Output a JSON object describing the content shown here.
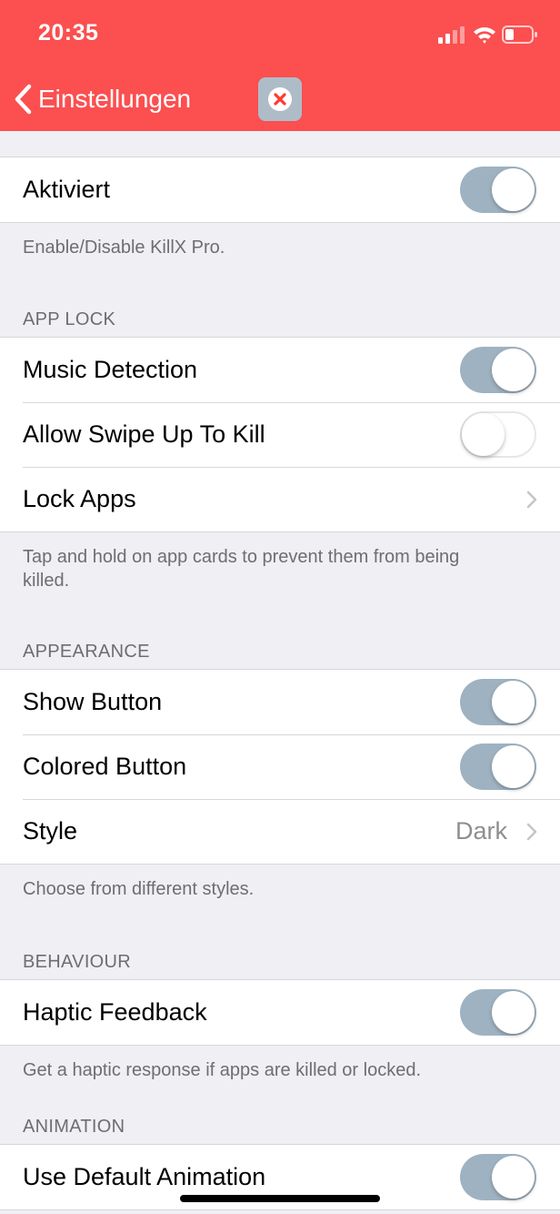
{
  "status_bar": {
    "time": "20:35"
  },
  "nav": {
    "back_label": "Einstellungen"
  },
  "sections": {
    "main": {
      "aktiviert_label": "Aktiviert",
      "aktiviert_on": true,
      "footer": "Enable/Disable KillX Pro."
    },
    "app_lock": {
      "header": "APP LOCK",
      "music_label": "Music Detection",
      "music_on": true,
      "swipe_label": "Allow Swipe Up To Kill",
      "swipe_on": false,
      "lock_apps_label": "Lock Apps",
      "footer": "Tap and hold on app cards to prevent them from being killed."
    },
    "appearance": {
      "header": "APPEARANCE",
      "show_button_label": "Show Button",
      "show_button_on": true,
      "colored_button_label": "Colored Button",
      "colored_button_on": true,
      "style_label": "Style",
      "style_value": "Dark",
      "footer": "Choose from different styles."
    },
    "behaviour": {
      "header": "BEHAVIOUR",
      "haptic_label": "Haptic Feedback",
      "haptic_on": true,
      "footer": "Get a haptic response if apps are killed or locked."
    },
    "animation": {
      "header": "ANIMATION",
      "default_anim_label": "Use Default Animation",
      "default_anim_on": true
    }
  },
  "colors": {
    "accent": "#fb4f50",
    "toggle_on": "#9fb2c1",
    "close_icon_bg": "#aebcc8",
    "close_icon_x": "#ff3b30"
  },
  "icons": [
    "cellular-signal-icon",
    "wifi-icon",
    "battery-icon",
    "back-chevron-icon",
    "close-x-icon",
    "disclosure-chevron-icon"
  ]
}
